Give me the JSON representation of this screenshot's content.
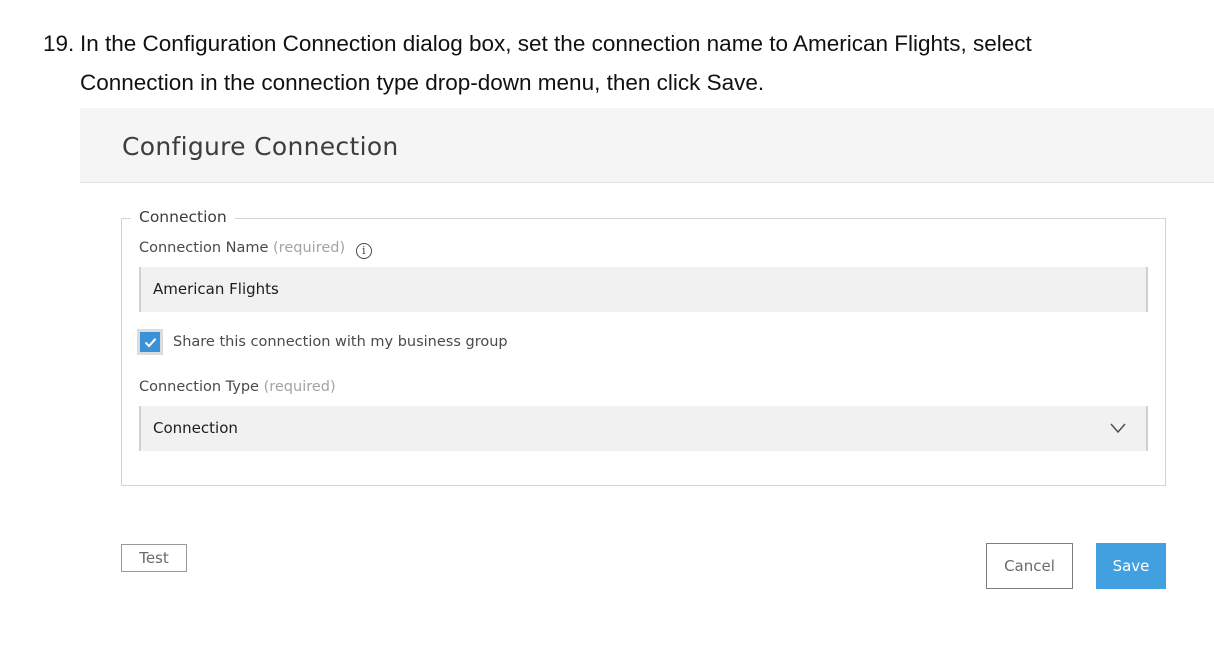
{
  "instruction": {
    "number": "19.",
    "line1": "In the Configuration Connection dialog box, set the connection name to American Flights, select",
    "line2": "Connection in the connection type drop-down menu, then click Save."
  },
  "dialog": {
    "title": "Configure Connection",
    "fieldset_legend": "Connection",
    "connection_name": {
      "label": "Connection Name",
      "required": "(required)",
      "info_icon": "info-icon",
      "value": "American Flights"
    },
    "share_checkbox": {
      "checked": true,
      "label": "Share this connection with my business group"
    },
    "connection_type": {
      "label": "Connection Type",
      "required": "(required)",
      "selected": "Connection",
      "icon": "chevron-down-icon"
    },
    "buttons": {
      "test": "Test",
      "cancel": "Cancel",
      "save": "Save"
    }
  },
  "colors": {
    "accent": "#3a91d8",
    "save_button": "#43a0e0",
    "header_bg": "#f5f5f5",
    "input_bg": "#f1f1f2"
  }
}
